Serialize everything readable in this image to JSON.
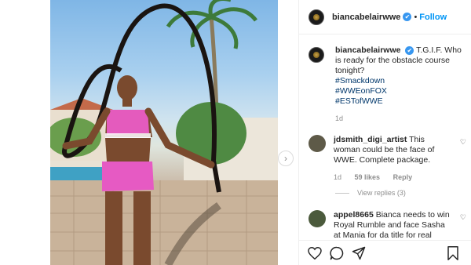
{
  "post": {
    "username": "biancabelairwwe",
    "verified_mark": "✔",
    "separator": "•",
    "follow_label": "Follow",
    "caption": {
      "text": "T.G.I.F. Who is ready for the obstacle course tonight?",
      "tags": [
        "#Smackdown",
        "#WWEonFOX",
        "#ESTofWWE"
      ],
      "age": "1d"
    },
    "next_arrow": "›"
  },
  "comments": [
    {
      "username": "jdsmith_digi_artist",
      "text": "This woman could be the face of WWE. Complete package.",
      "age": "1d",
      "likes": "59 likes",
      "reply_label": "Reply",
      "avatar_color": "#5e5a48"
    },
    {
      "username": "appel8665",
      "text": "Bianca needs to win Royal Rumble and face Sasha at Mania for da title for real",
      "avatar_color": "#4b5a3c"
    }
  ],
  "view_replies": "View replies (3)",
  "icons": {
    "like": "heart-icon",
    "comment": "comment-icon",
    "share": "share-icon",
    "save": "bookmark-icon"
  },
  "colors": {
    "link": "#00376b",
    "follow": "#0095f6",
    "verified": "#3897f0",
    "muted": "#8e8e8e"
  }
}
